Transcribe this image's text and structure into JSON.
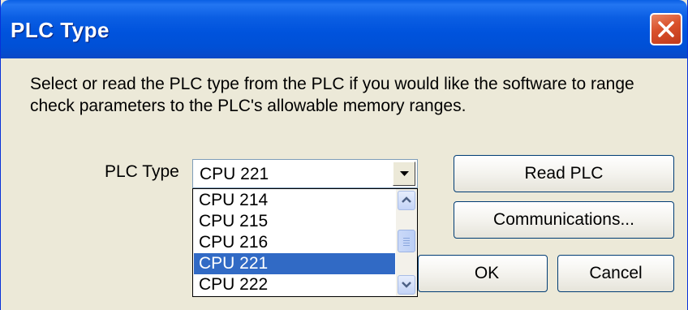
{
  "window": {
    "title": "PLC Type",
    "close_label": "×"
  },
  "message": "Select or read the PLC type from the PLC if you would like the software to range check parameters to the PLC's allowable memory ranges.",
  "plc_type": {
    "label": "PLC Type",
    "selected_value": "CPU 221",
    "options": [
      "CPU 214",
      "CPU 215",
      "CPU 216",
      "CPU 221",
      "CPU 222"
    ],
    "highlighted_option": "CPU 221"
  },
  "buttons": {
    "read_plc": "Read PLC",
    "communications": "Communications...",
    "ok": "OK",
    "cancel": "Cancel"
  },
  "colors": {
    "titlebar": "#0053dd",
    "dialog_bg": "#ece9d8",
    "selection": "#316ac5",
    "close_button": "#d9512b"
  },
  "icons": {
    "close": "close-icon",
    "combo_arrow": "chevron-down-icon",
    "scroll_up": "chevron-up-icon",
    "scroll_down": "chevron-down-icon"
  }
}
